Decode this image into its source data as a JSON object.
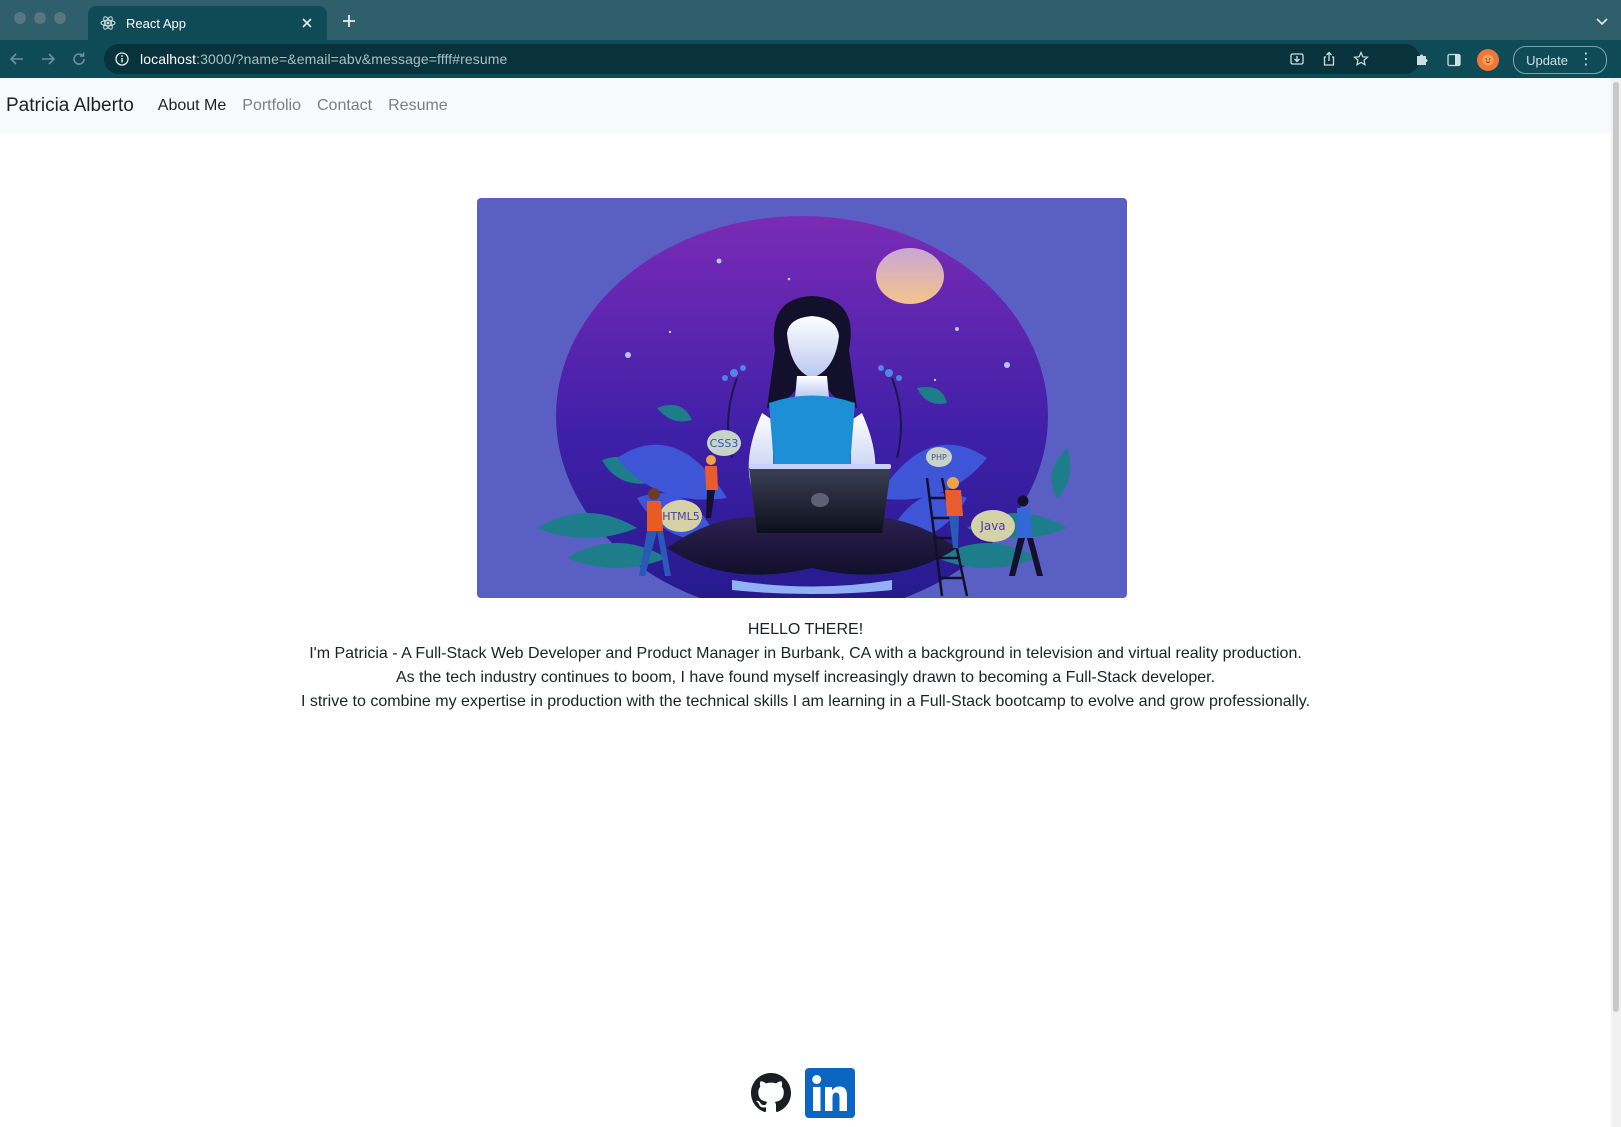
{
  "browser": {
    "tab_title": "React App",
    "url_host": "localhost",
    "url_rest": ":3000/?name=&email=abv&message=ffff#resume",
    "update_label": "Update"
  },
  "nav": {
    "brand": "Patricia Alberto",
    "links": [
      "About Me",
      "Portfolio",
      "Contact",
      "Resume"
    ],
    "active": "About Me"
  },
  "hero": {
    "badges": [
      "CSS3",
      "PHP",
      "HTML5",
      "Java"
    ]
  },
  "about": {
    "lines": [
      "HELLO THERE!",
      "I'm Patricia - A Full-Stack Web Developer and Product Manager in Burbank, CA with a background in television and virtual reality production.",
      "As the tech industry continues to boom, I have found myself increasingly drawn to becoming a Full-Stack developer.",
      "I strive to combine my expertise in production with the technical skills I am learning in a Full-Stack bootcamp to evolve and grow professionally."
    ]
  },
  "socials": [
    {
      "name": "github-icon"
    },
    {
      "name": "linkedin-icon"
    }
  ],
  "colors": {
    "chrome_tabbar": "#2e5f6a",
    "chrome_toolbar": "#0f4a57",
    "navbar_bg": "#f8f9fa",
    "hero_bg": "#5a5fc4",
    "linkedin_blue": "#0a66c2"
  }
}
